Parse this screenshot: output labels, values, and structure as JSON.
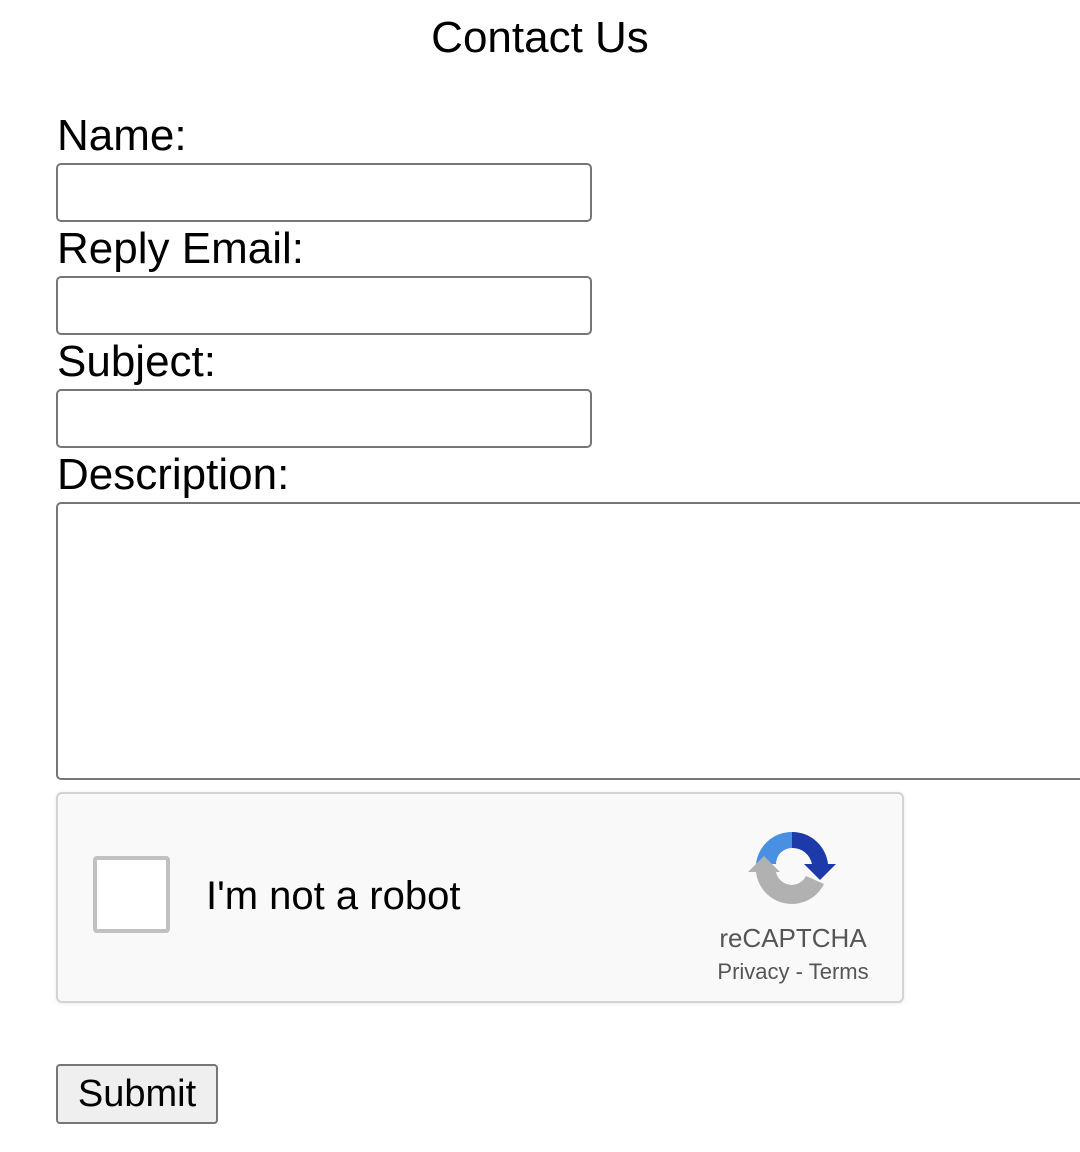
{
  "page": {
    "title": "Contact Us"
  },
  "form": {
    "name": {
      "label": "Name:",
      "value": ""
    },
    "reply_email": {
      "label": "Reply Email:",
      "value": ""
    },
    "subject": {
      "label": "Subject:",
      "value": ""
    },
    "description": {
      "label": "Description:",
      "value": ""
    },
    "submit_label": "Submit"
  },
  "recaptcha": {
    "checkbox_label": "I'm not a robot",
    "checked": false,
    "brand": "reCAPTCHA",
    "privacy_link": "Privacy",
    "separator": "-",
    "terms_link": "Terms",
    "icon": "recaptcha-logo",
    "colors": {
      "blue_dark": "#1c3aa9",
      "blue_light": "#4a90e2",
      "gray": "#b1b1b1"
    }
  }
}
